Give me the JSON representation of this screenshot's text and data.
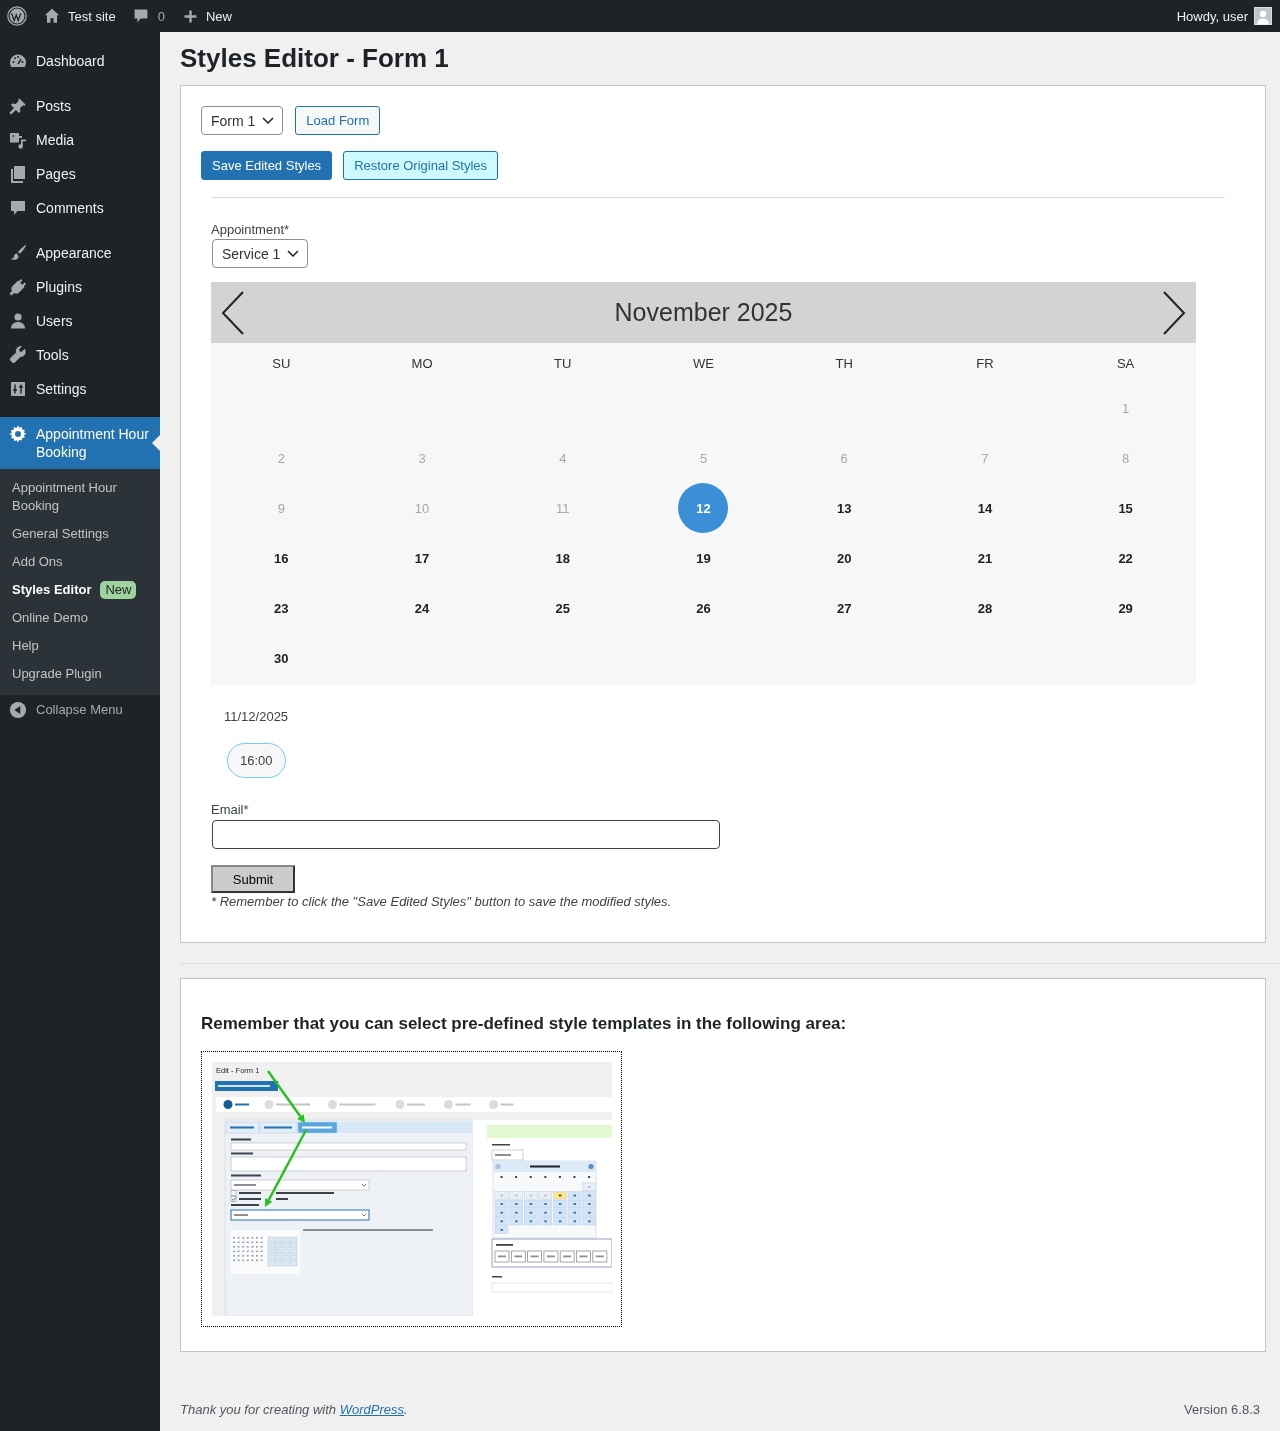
{
  "admin_bar": {
    "site_name": "Test site",
    "comment_count": "0",
    "new_label": "New",
    "greeting": "Howdy, user"
  },
  "sidebar": {
    "groups": [
      [
        {
          "label": "Dashboard",
          "selected": false
        }
      ],
      [
        {
          "label": "Posts",
          "selected": false
        },
        {
          "label": "Media",
          "selected": false
        },
        {
          "label": "Pages",
          "selected": false
        },
        {
          "label": "Comments",
          "selected": false
        }
      ],
      [
        {
          "label": "Appearance",
          "selected": false
        },
        {
          "label": "Plugins",
          "selected": false
        },
        {
          "label": "Users",
          "selected": false
        },
        {
          "label": "Tools",
          "selected": false
        },
        {
          "label": "Settings",
          "selected": false
        }
      ],
      [
        {
          "label": "Appointment Hour Booking",
          "selected": true,
          "submenu": [
            {
              "label": "Appointment Hour Booking",
              "selected": false
            },
            {
              "label": "General Settings",
              "selected": false
            },
            {
              "label": "Add Ons",
              "selected": false
            },
            {
              "label": "Styles Editor",
              "selected": true,
              "badge": "New"
            },
            {
              "label": "Online Demo",
              "selected": false
            },
            {
              "label": "Help",
              "selected": false
            },
            {
              "label": "Upgrade Plugin",
              "selected": false
            }
          ]
        }
      ]
    ],
    "collapse_label": "Collapse Menu"
  },
  "page_title": "Styles Editor - Form 1",
  "editor": {
    "form_select": "Form 1",
    "load_button": "Load Form",
    "save_button": "Save Edited Styles",
    "restore_button": "Restore Original Styles",
    "preview": {
      "appointment_label": "Appointment*",
      "service_select": "Service 1",
      "calendar": {
        "title": "November 2025",
        "weekdays": [
          "SU",
          "MO",
          "TU",
          "WE",
          "TH",
          "FR",
          "SA"
        ],
        "weeks": [
          [
            {
              "label": "1",
              "disabled": true,
              "selected": false
            }
          ],
          [
            {
              "label": "2",
              "disabled": true,
              "selected": false
            },
            {
              "label": "3",
              "disabled": true,
              "selected": false
            },
            {
              "label": "4",
              "disabled": true,
              "selected": false
            },
            {
              "label": "5",
              "disabled": true,
              "selected": false
            },
            {
              "label": "6",
              "disabled": true,
              "selected": false
            },
            {
              "label": "7",
              "disabled": true,
              "selected": false
            },
            {
              "label": "8",
              "disabled": true,
              "selected": false
            }
          ],
          [
            {
              "label": "9",
              "disabled": true,
              "selected": false
            },
            {
              "label": "10",
              "disabled": true,
              "selected": false
            },
            {
              "label": "11",
              "disabled": true,
              "selected": false
            },
            {
              "label": "12",
              "disabled": false,
              "selected": true
            },
            {
              "label": "13",
              "disabled": false,
              "selected": false
            },
            {
              "label": "14",
              "disabled": false,
              "selected": false
            },
            {
              "label": "15",
              "disabled": false,
              "selected": false
            }
          ],
          [
            {
              "label": "16",
              "disabled": false,
              "selected": false
            },
            {
              "label": "17",
              "disabled": false,
              "selected": false
            },
            {
              "label": "18",
              "disabled": false,
              "selected": false
            },
            {
              "label": "19",
              "disabled": false,
              "selected": false
            },
            {
              "label": "20",
              "disabled": false,
              "selected": false
            },
            {
              "label": "21",
              "disabled": false,
              "selected": false
            },
            {
              "label": "22",
              "disabled": false,
              "selected": false
            }
          ],
          [
            {
              "label": "23",
              "disabled": false,
              "selected": false
            },
            {
              "label": "24",
              "disabled": false,
              "selected": false
            },
            {
              "label": "25",
              "disabled": false,
              "selected": false
            },
            {
              "label": "26",
              "disabled": false,
              "selected": false
            },
            {
              "label": "27",
              "disabled": false,
              "selected": false
            },
            {
              "label": "28",
              "disabled": false,
              "selected": false
            },
            {
              "label": "29",
              "disabled": false,
              "selected": false
            }
          ],
          [
            {
              "label": "30",
              "disabled": false,
              "selected": false
            }
          ]
        ]
      },
      "selected_date": "11/12/2025",
      "time_slots": [
        "16:00"
      ],
      "email_label": "Email*",
      "submit_button": "Submit"
    },
    "note": "* Remember to click the \"Save Edited Styles\" button to save the modified styles."
  },
  "templates": {
    "heading": "Remember that you can select pre-defined style templates in the following area:",
    "screenshot": {
      "title": "Edit - Form 1"
    }
  },
  "footer": {
    "text": "Thank you for creating with ",
    "link": "WordPress",
    "text_end": ".",
    "version": "Version 6.8.3"
  }
}
